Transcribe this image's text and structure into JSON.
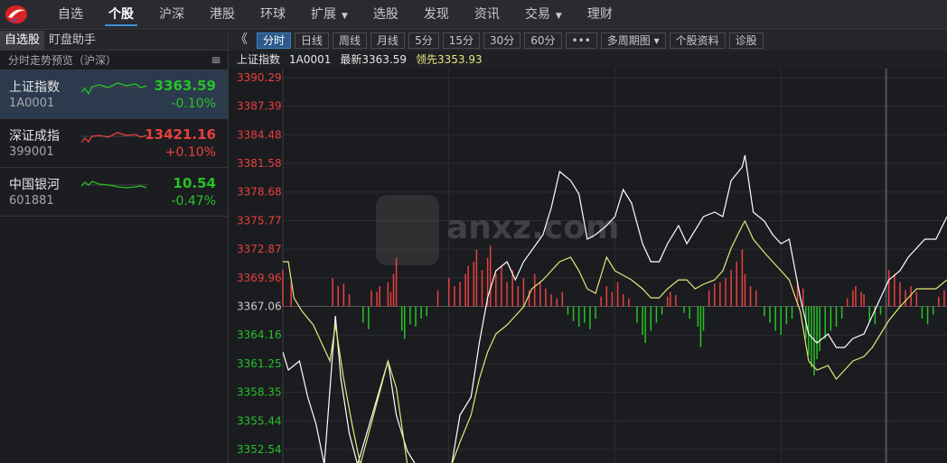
{
  "nav": {
    "items": [
      "自选",
      "个股",
      "沪深",
      "港股",
      "环球",
      "扩展",
      "选股",
      "发现",
      "资讯",
      "交易",
      "理财"
    ],
    "active": "个股",
    "dropdowns": [
      "扩展",
      "交易"
    ]
  },
  "sidebar": {
    "tabs": [
      "自选股",
      "盯盘助手"
    ],
    "active_tab": "自选股",
    "header": "分时走势预览（沪深）",
    "menu_icon": "hamburger-icon",
    "items": [
      {
        "name": "上证指数",
        "code": "1A0001",
        "price": "3363.59",
        "change": "-0.10%",
        "trend": "down",
        "selected": true
      },
      {
        "name": "深证成指",
        "code": "399001",
        "price": "13421.16",
        "change": "+0.10%",
        "trend": "up",
        "selected": false
      },
      {
        "name": "中国银河",
        "code": "601881",
        "price": "10.54",
        "change": "-0.47%",
        "trend": "down",
        "selected": false
      }
    ]
  },
  "toolbar": {
    "collapse": "《",
    "buttons": [
      "分时",
      "日线",
      "周线",
      "月线",
      "5分",
      "15分",
      "30分",
      "60分",
      "•••",
      "多周期图",
      "个股资料",
      "诊股"
    ],
    "active": "分时"
  },
  "info": {
    "name": "上证指数",
    "code": "1A0001",
    "latest": "最新3363.59",
    "leading": "领先3353.93"
  },
  "watermark": "anxz.com",
  "colors": {
    "up": "#e8403e",
    "down": "#27c227",
    "price_line": "#ffffff",
    "lead_line": "#e6e67a",
    "accent": "#3f8fd8"
  },
  "chart_data": {
    "type": "line",
    "prev_close": 3367.06,
    "ylim": [
      3351.0,
      3390.29
    ],
    "xlim": [
      0,
      240
    ],
    "y_ticks": [
      "3390.29",
      "3387.39",
      "3384.48",
      "3381.58",
      "3378.68",
      "3375.77",
      "3372.87",
      "3369.96",
      "3367.06",
      "3364.16",
      "3361.25",
      "3358.35",
      "3355.44",
      "3352.54"
    ],
    "series": [
      {
        "key": "price",
        "points": [
          [
            0,
            3362.43
          ],
          [
            2,
            3360.6
          ],
          [
            6,
            3361.52
          ],
          [
            9,
            3357.85
          ],
          [
            12,
            3355.1
          ],
          [
            15,
            3351.0
          ],
          [
            19,
            3366.1
          ],
          [
            21,
            3359.69
          ],
          [
            24,
            3354.19
          ],
          [
            27,
            3351.0
          ],
          [
            38,
            3361.52
          ],
          [
            41,
            3356.02
          ],
          [
            45,
            3352.36
          ],
          [
            48,
            3351.0
          ],
          [
            61,
            3351.0
          ],
          [
            64,
            3356.02
          ],
          [
            68,
            3357.85
          ],
          [
            71,
            3363.35
          ],
          [
            74,
            3367.93
          ],
          [
            77,
            3370.68
          ],
          [
            81,
            3371.6
          ],
          [
            84,
            3369.76
          ],
          [
            87,
            3371.6
          ],
          [
            94,
            3374.35
          ],
          [
            97,
            3377.1
          ],
          [
            100,
            3380.76
          ],
          [
            104,
            3379.84
          ],
          [
            107,
            3378.47
          ],
          [
            110,
            3373.89
          ],
          [
            113,
            3374.35
          ],
          [
            117,
            3375.26
          ],
          [
            120,
            3376.18
          ],
          [
            123,
            3378.93
          ],
          [
            126,
            3377.55
          ],
          [
            130,
            3373.43
          ],
          [
            133,
            3371.6
          ],
          [
            136,
            3371.6
          ],
          [
            139,
            3373.43
          ],
          [
            143,
            3375.26
          ],
          [
            146,
            3373.43
          ],
          [
            149,
            3374.8
          ],
          [
            152,
            3376.18
          ],
          [
            156,
            3376.64
          ],
          [
            159,
            3376.18
          ],
          [
            162,
            3379.84
          ],
          [
            166,
            3381.22
          ],
          [
            167,
            3382.41
          ],
          [
            170,
            3376.64
          ],
          [
            174,
            3375.72
          ],
          [
            177,
            3374.35
          ],
          [
            180,
            3373.43
          ],
          [
            183,
            3373.89
          ],
          [
            187,
            3367.93
          ],
          [
            190,
            3364.27
          ],
          [
            193,
            3363.35
          ],
          [
            197,
            3364.27
          ],
          [
            200,
            3362.89
          ],
          [
            203,
            3362.89
          ],
          [
            206,
            3363.81
          ],
          [
            210,
            3364.27
          ],
          [
            213,
            3366.1
          ],
          [
            216,
            3367.93
          ],
          [
            219,
            3369.76
          ],
          [
            223,
            3370.68
          ],
          [
            226,
            3372.06
          ],
          [
            229,
            3372.97
          ],
          [
            232,
            3373.89
          ],
          [
            236,
            3373.89
          ],
          [
            240,
            3376.18
          ]
        ]
      },
      {
        "key": "leading",
        "points": [
          [
            0,
            3371.6
          ],
          [
            2,
            3371.6
          ],
          [
            4,
            3367.93
          ],
          [
            7,
            3366.56
          ],
          [
            11,
            3365.18
          ],
          [
            14,
            3363.35
          ],
          [
            17,
            3361.52
          ],
          [
            19,
            3365.18
          ],
          [
            22,
            3359.69
          ],
          [
            25,
            3355.1
          ],
          [
            28,
            3351.0
          ],
          [
            38,
            3361.52
          ],
          [
            41,
            3358.77
          ],
          [
            45,
            3351.0
          ],
          [
            61,
            3351.0
          ],
          [
            64,
            3353.27
          ],
          [
            68,
            3356.02
          ],
          [
            71,
            3359.69
          ],
          [
            74,
            3362.43
          ],
          [
            77,
            3364.27
          ],
          [
            81,
            3365.18
          ],
          [
            84,
            3366.1
          ],
          [
            87,
            3367.02
          ],
          [
            90,
            3368.85
          ],
          [
            94,
            3369.76
          ],
          [
            97,
            3370.68
          ],
          [
            100,
            3371.6
          ],
          [
            104,
            3372.06
          ],
          [
            107,
            3370.68
          ],
          [
            110,
            3368.85
          ],
          [
            113,
            3368.39
          ],
          [
            117,
            3372.06
          ],
          [
            120,
            3370.68
          ],
          [
            123,
            3370.22
          ],
          [
            126,
            3369.76
          ],
          [
            130,
            3368.85
          ],
          [
            133,
            3367.93
          ],
          [
            136,
            3367.93
          ],
          [
            139,
            3368.85
          ],
          [
            143,
            3369.76
          ],
          [
            146,
            3369.76
          ],
          [
            149,
            3368.85
          ],
          [
            152,
            3369.31
          ],
          [
            156,
            3369.76
          ],
          [
            159,
            3370.68
          ],
          [
            162,
            3372.97
          ],
          [
            166,
            3375.26
          ],
          [
            167,
            3375.72
          ],
          [
            170,
            3373.89
          ],
          [
            174,
            3372.52
          ],
          [
            177,
            3371.6
          ],
          [
            180,
            3370.68
          ],
          [
            183,
            3369.76
          ],
          [
            187,
            3366.56
          ],
          [
            190,
            3361.52
          ],
          [
            193,
            3360.6
          ],
          [
            197,
            3361.06
          ],
          [
            200,
            3359.69
          ],
          [
            203,
            3360.6
          ],
          [
            206,
            3361.52
          ],
          [
            210,
            3361.98
          ],
          [
            213,
            3362.89
          ],
          [
            216,
            3364.27
          ],
          [
            219,
            3365.64
          ],
          [
            223,
            3367.02
          ],
          [
            226,
            3367.93
          ],
          [
            229,
            3368.85
          ],
          [
            232,
            3368.85
          ],
          [
            236,
            3368.85
          ],
          [
            240,
            3369.76
          ]
        ]
      }
    ],
    "bars": [
      [
        0,
        45
      ],
      [
        3,
        30
      ],
      [
        18,
        35
      ],
      [
        20,
        25
      ],
      [
        22,
        28
      ],
      [
        24,
        15
      ],
      [
        29,
        -20
      ],
      [
        31,
        -28
      ],
      [
        32,
        20
      ],
      [
        34,
        18
      ],
      [
        35,
        25
      ],
      [
        38,
        30
      ],
      [
        39,
        18
      ],
      [
        40,
        40
      ],
      [
        41,
        60
      ],
      [
        43,
        -30
      ],
      [
        44,
        -40
      ],
      [
        46,
        -22
      ],
      [
        48,
        -25
      ],
      [
        50,
        -15
      ],
      [
        52,
        -12
      ],
      [
        56,
        20
      ],
      [
        60,
        35
      ],
      [
        62,
        25
      ],
      [
        64,
        30
      ],
      [
        66,
        40
      ],
      [
        67,
        50
      ],
      [
        69,
        55
      ],
      [
        70,
        70
      ],
      [
        72,
        45
      ],
      [
        74,
        60
      ],
      [
        75,
        75
      ],
      [
        77,
        40
      ],
      [
        79,
        50
      ],
      [
        81,
        30
      ],
      [
        83,
        45
      ],
      [
        85,
        25
      ],
      [
        87,
        35
      ],
      [
        89,
        20
      ],
      [
        91,
        40
      ],
      [
        93,
        30
      ],
      [
        95,
        22
      ],
      [
        97,
        15
      ],
      [
        99,
        10
      ],
      [
        101,
        18
      ],
      [
        103,
        -10
      ],
      [
        105,
        -18
      ],
      [
        107,
        -25
      ],
      [
        109,
        -20
      ],
      [
        111,
        -28
      ],
      [
        113,
        -15
      ],
      [
        115,
        12
      ],
      [
        117,
        25
      ],
      [
        119,
        18
      ],
      [
        121,
        30
      ],
      [
        123,
        15
      ],
      [
        125,
        10
      ],
      [
        128,
        -20
      ],
      [
        130,
        -35
      ],
      [
        131,
        -45
      ],
      [
        133,
        -30
      ],
      [
        135,
        -20
      ],
      [
        137,
        -10
      ],
      [
        139,
        12
      ],
      [
        140,
        18
      ],
      [
        142,
        14
      ],
      [
        145,
        -8
      ],
      [
        147,
        -15
      ],
      [
        150,
        -25
      ],
      [
        151,
        -50
      ],
      [
        152,
        -30
      ],
      [
        154,
        20
      ],
      [
        156,
        28
      ],
      [
        158,
        30
      ],
      [
        160,
        35
      ],
      [
        162,
        45
      ],
      [
        164,
        55
      ],
      [
        166,
        70
      ],
      [
        167,
        40
      ],
      [
        169,
        25
      ],
      [
        171,
        20
      ],
      [
        174,
        -12
      ],
      [
        176,
        -20
      ],
      [
        178,
        -30
      ],
      [
        180,
        -35
      ],
      [
        182,
        -22
      ],
      [
        184,
        -15
      ],
      [
        186,
        28
      ],
      [
        188,
        22
      ],
      [
        189,
        -40
      ],
      [
        190,
        -60
      ],
      [
        191,
        -75
      ],
      [
        192,
        -85
      ],
      [
        193,
        -65
      ],
      [
        194,
        -55
      ],
      [
        196,
        -40
      ],
      [
        198,
        -30
      ],
      [
        200,
        -25
      ],
      [
        202,
        -15
      ],
      [
        204,
        10
      ],
      [
        206,
        20
      ],
      [
        207,
        25
      ],
      [
        209,
        18
      ],
      [
        210,
        15
      ],
      [
        212,
        -18
      ],
      [
        214,
        -22
      ],
      [
        216,
        -10
      ],
      [
        219,
        45
      ],
      [
        221,
        40
      ],
      [
        223,
        30
      ],
      [
        225,
        20
      ],
      [
        227,
        25
      ],
      [
        229,
        18
      ],
      [
        231,
        -15
      ],
      [
        233,
        -22
      ],
      [
        235,
        -10
      ],
      [
        237,
        12
      ],
      [
        239,
        20
      ]
    ]
  }
}
